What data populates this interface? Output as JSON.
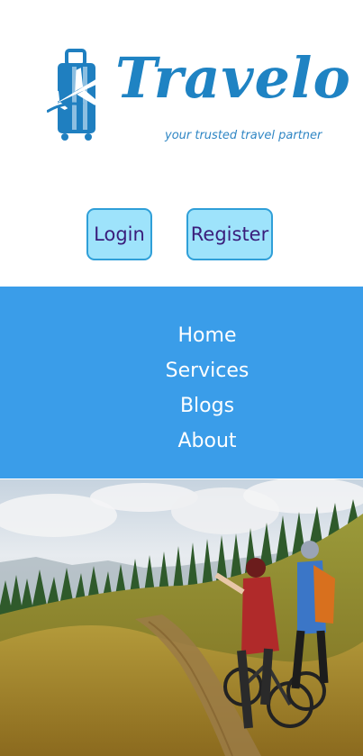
{
  "brand": {
    "name": "Travelo",
    "tagline": "your trusted travel partner",
    "icon": "luggage-plane-icon",
    "color": "#1f83c3"
  },
  "auth": {
    "login_label": "Login",
    "register_label": "Register",
    "button_bg": "#9ee3fb",
    "button_text": "#3a1d7b"
  },
  "nav": {
    "bg": "#3a9de9",
    "items": [
      {
        "label": "Home"
      },
      {
        "label": "Services"
      },
      {
        "label": "Blogs"
      },
      {
        "label": "About"
      }
    ]
  },
  "hero": {
    "image": "hero-cyclists-hillside-photo"
  }
}
